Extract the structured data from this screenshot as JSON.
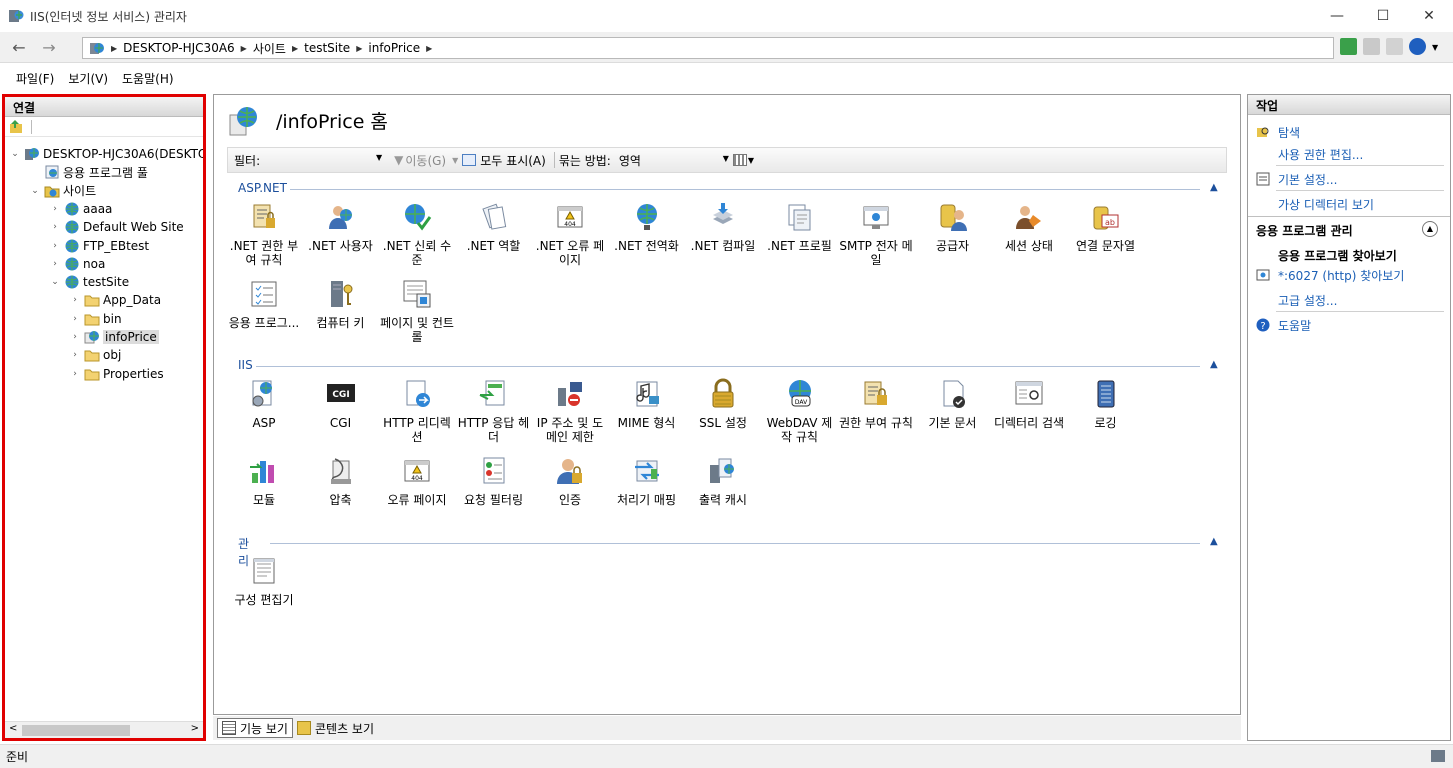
{
  "window": {
    "title": "IIS(인터넷 정보 서비스) 관리자",
    "minimize": "—",
    "maximize": "☐",
    "close": "✕"
  },
  "address": {
    "crumbs": [
      "DESKTOP-HJC30A6",
      "사이트",
      "testSite",
      "infoPrice"
    ]
  },
  "menu": [
    "파일(F)",
    "보기(V)",
    "도움말(H)"
  ],
  "connections": {
    "header": "연결",
    "tree": [
      {
        "label": "DESKTOP-HJC30A6(DESKTO",
        "level": 0,
        "exp": "v",
        "icon": "server"
      },
      {
        "label": "응용 프로그램 풀",
        "level": 1,
        "exp": "",
        "icon": "apppool"
      },
      {
        "label": "사이트",
        "level": 1,
        "exp": "v",
        "icon": "sitesfolder"
      },
      {
        "label": "aaaa",
        "level": 2,
        "exp": ">",
        "icon": "globe"
      },
      {
        "label": "Default Web Site",
        "level": 2,
        "exp": ">",
        "icon": "globe"
      },
      {
        "label": "FTP_EBtest",
        "level": 2,
        "exp": ">",
        "icon": "globe"
      },
      {
        "label": "noa",
        "level": 2,
        "exp": ">",
        "icon": "globe"
      },
      {
        "label": "testSite",
        "level": 2,
        "exp": "v",
        "icon": "globe"
      },
      {
        "label": "App_Data",
        "level": 3,
        "exp": ">",
        "icon": "folder"
      },
      {
        "label": "bin",
        "level": 3,
        "exp": ">",
        "icon": "folder"
      },
      {
        "label": "infoPrice",
        "level": 3,
        "exp": ">",
        "icon": "app",
        "selected": true
      },
      {
        "label": "obj",
        "level": 3,
        "exp": ">",
        "icon": "folder"
      },
      {
        "label": "Properties",
        "level": 3,
        "exp": ">",
        "icon": "folder"
      }
    ]
  },
  "main": {
    "title": "/infoPrice 홈",
    "filter": {
      "label": "필터:",
      "go": "이동(G)",
      "showall": "모두 표시(A)",
      "groupby": "묶는 방법:",
      "groupvalue": "영역"
    },
    "groups": [
      {
        "name": "ASP.NET",
        "items": [
          {
            "label": ".NET 권한 부여 규칙",
            "icon": "netauth"
          },
          {
            "label": ".NET 사용자",
            "icon": "netusers"
          },
          {
            "label": ".NET 신뢰 수준",
            "icon": "nettrust"
          },
          {
            "label": ".NET 역할",
            "icon": "netroles"
          },
          {
            "label": ".NET 오류 페이지",
            "icon": "err404"
          },
          {
            "label": ".NET 전역화",
            "icon": "globe"
          },
          {
            "label": ".NET 컴파일",
            "icon": "compile"
          },
          {
            "label": ".NET 프로필",
            "icon": "profile"
          },
          {
            "label": "SMTP 전자 메일",
            "icon": "smtp"
          },
          {
            "label": "공급자",
            "icon": "providers"
          },
          {
            "label": "세션 상태",
            "icon": "session"
          },
          {
            "label": "연결 문자열",
            "icon": "connstr"
          },
          {
            "label": "응용 프로그...",
            "icon": "appsettings"
          },
          {
            "label": "컴퓨터 키",
            "icon": "machinekey"
          },
          {
            "label": "페이지 및 컨트롤",
            "icon": "pages"
          }
        ]
      },
      {
        "name": "IIS",
        "items": [
          {
            "label": "ASP",
            "icon": "asp"
          },
          {
            "label": "CGI",
            "icon": "cgi"
          },
          {
            "label": "HTTP 리디렉션",
            "icon": "redirect"
          },
          {
            "label": "HTTP 응답 헤더",
            "icon": "headers"
          },
          {
            "label": "IP 주소 및 도메인 제한",
            "icon": "iprestrict"
          },
          {
            "label": "MIME 형식",
            "icon": "mime"
          },
          {
            "label": "SSL 설정",
            "icon": "lock"
          },
          {
            "label": "WebDAV 제작 규칙",
            "icon": "webdav"
          },
          {
            "label": "권한 부여 규칙",
            "icon": "authz"
          },
          {
            "label": "기본 문서",
            "icon": "defaultdoc"
          },
          {
            "label": "디렉터리 검색",
            "icon": "dirbrowse"
          },
          {
            "label": "로깅",
            "icon": "logging"
          },
          {
            "label": "모듈",
            "icon": "modules"
          },
          {
            "label": "압축",
            "icon": "compress"
          },
          {
            "label": "오류 페이지",
            "icon": "err404"
          },
          {
            "label": "요청 필터링",
            "icon": "reqfilter"
          },
          {
            "label": "인증",
            "icon": "authn"
          },
          {
            "label": "처리기 매핑",
            "icon": "handlers"
          },
          {
            "label": "출력 캐시",
            "icon": "outcache"
          }
        ]
      },
      {
        "name": "관리",
        "items": [
          {
            "label": "구성 편집기",
            "icon": "configed"
          }
        ]
      }
    ],
    "tabs": [
      "기능 보기",
      "콘텐츠 보기"
    ]
  },
  "actions": {
    "header": "작업",
    "explore": "탐색",
    "edit_perm": "사용 권한 편집...",
    "basic": "기본 설정...",
    "vdirs": "가상 디렉터리 보기",
    "manage_hdr": "응용 프로그램 관리",
    "browse_hdr": "응용 프로그램 찾아보기",
    "browse_link": "*:6027 (http) 찾아보기",
    "advanced": "고급 설정...",
    "help": "도움말"
  },
  "status": {
    "text": "준비"
  },
  "colors": {
    "accent_link": "#1b5fb5",
    "selection_border": "#e00000",
    "group_header": "#1c4f9c"
  }
}
